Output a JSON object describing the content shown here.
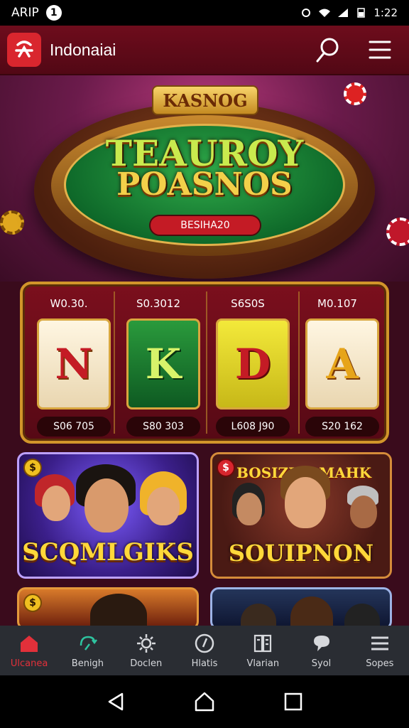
{
  "status_bar": {
    "carrier": "ARIP",
    "notif_count": "1",
    "time": "1:22"
  },
  "header": {
    "app_title": "Indonaiai"
  },
  "hero": {
    "badge_text": "KASNOG",
    "headline_1": "TEAUROY",
    "headline_2": "POASNOS",
    "button_text": "BESIHA20"
  },
  "slots": [
    {
      "amount": "W0.30.",
      "symbol": "N",
      "payout": "S06 705"
    },
    {
      "amount": "S0.3012",
      "symbol": "K",
      "payout": "S80 303"
    },
    {
      "amount": "S6S0S",
      "symbol": "D",
      "payout": "L608 J90"
    },
    {
      "amount": "M0.107",
      "symbol": "A",
      "payout": "S20 162"
    }
  ],
  "games": [
    {
      "title": "SCQMLGIKS",
      "badge": "$"
    },
    {
      "title": "SOUIPNON",
      "badge": "$",
      "tag_left": "BOSIZI!",
      "tag_right": "MAHK"
    }
  ],
  "nav": [
    {
      "label": "Ulcanea",
      "icon": "home-icon"
    },
    {
      "label": "Benigh",
      "icon": "refresh-icon"
    },
    {
      "label": "Doclen",
      "icon": "settings-icon"
    },
    {
      "label": "Hlatis",
      "icon": "clock-icon"
    },
    {
      "label": "Vlarian",
      "icon": "document-icon"
    },
    {
      "label": "Syol",
      "icon": "chat-icon"
    },
    {
      "label": "Sopes",
      "icon": "menu-icon"
    }
  ],
  "colors": {
    "accent": "#e2303a",
    "header_bg": "#6e0c1c",
    "gold": "#d2952a"
  }
}
